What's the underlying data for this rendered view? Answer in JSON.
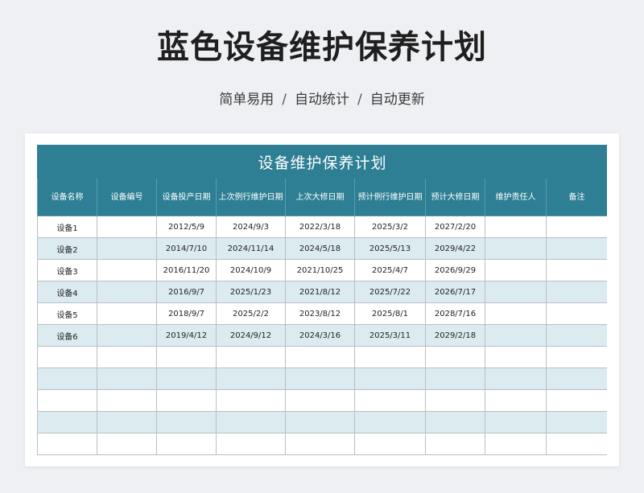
{
  "title": "蓝色设备维护保养计划",
  "subtitle": {
    "items": [
      "简单易用",
      "自动统计",
      "自动更新"
    ],
    "separator": "/"
  },
  "colors": {
    "header_bg": "#2e7f94",
    "stripe_bg": "#dcebf0",
    "page_bg": "#eef0f3"
  },
  "table": {
    "banner": "设备维护保养计划",
    "columns": [
      "设备名称",
      "设备编号",
      "设备投产日期",
      "上次例行维护日期",
      "上次大修日期",
      "预计例行维护日期",
      "预计大修日期",
      "维护责任人",
      "备注"
    ],
    "rows": [
      [
        "设备1",
        "",
        "2012/5/9",
        "2024/9/3",
        "2022/3/18",
        "2025/3/2",
        "2027/2/20",
        "",
        ""
      ],
      [
        "设备2",
        "",
        "2014/7/10",
        "2024/11/14",
        "2024/5/18",
        "2025/5/13",
        "2029/4/22",
        "",
        ""
      ],
      [
        "设备3",
        "",
        "2016/11/20",
        "2024/10/9",
        "2021/10/25",
        "2025/4/7",
        "2026/9/29",
        "",
        ""
      ],
      [
        "设备4",
        "",
        "2016/9/7",
        "2025/1/23",
        "2021/8/12",
        "2025/7/22",
        "2026/7/17",
        "",
        ""
      ],
      [
        "设备5",
        "",
        "2018/9/7",
        "2025/2/2",
        "2023/8/12",
        "2025/8/1",
        "2028/7/16",
        "",
        ""
      ],
      [
        "设备6",
        "",
        "2019/4/12",
        "2024/9/12",
        "2024/3/16",
        "2025/3/11",
        "2029/2/18",
        "",
        ""
      ],
      [
        "",
        "",
        "",
        "",
        "",
        "",
        "",
        "",
        ""
      ],
      [
        "",
        "",
        "",
        "",
        "",
        "",
        "",
        "",
        ""
      ],
      [
        "",
        "",
        "",
        "",
        "",
        "",
        "",
        "",
        ""
      ],
      [
        "",
        "",
        "",
        "",
        "",
        "",
        "",
        "",
        ""
      ],
      [
        "",
        "",
        "",
        "",
        "",
        "",
        "",
        "",
        ""
      ]
    ]
  }
}
